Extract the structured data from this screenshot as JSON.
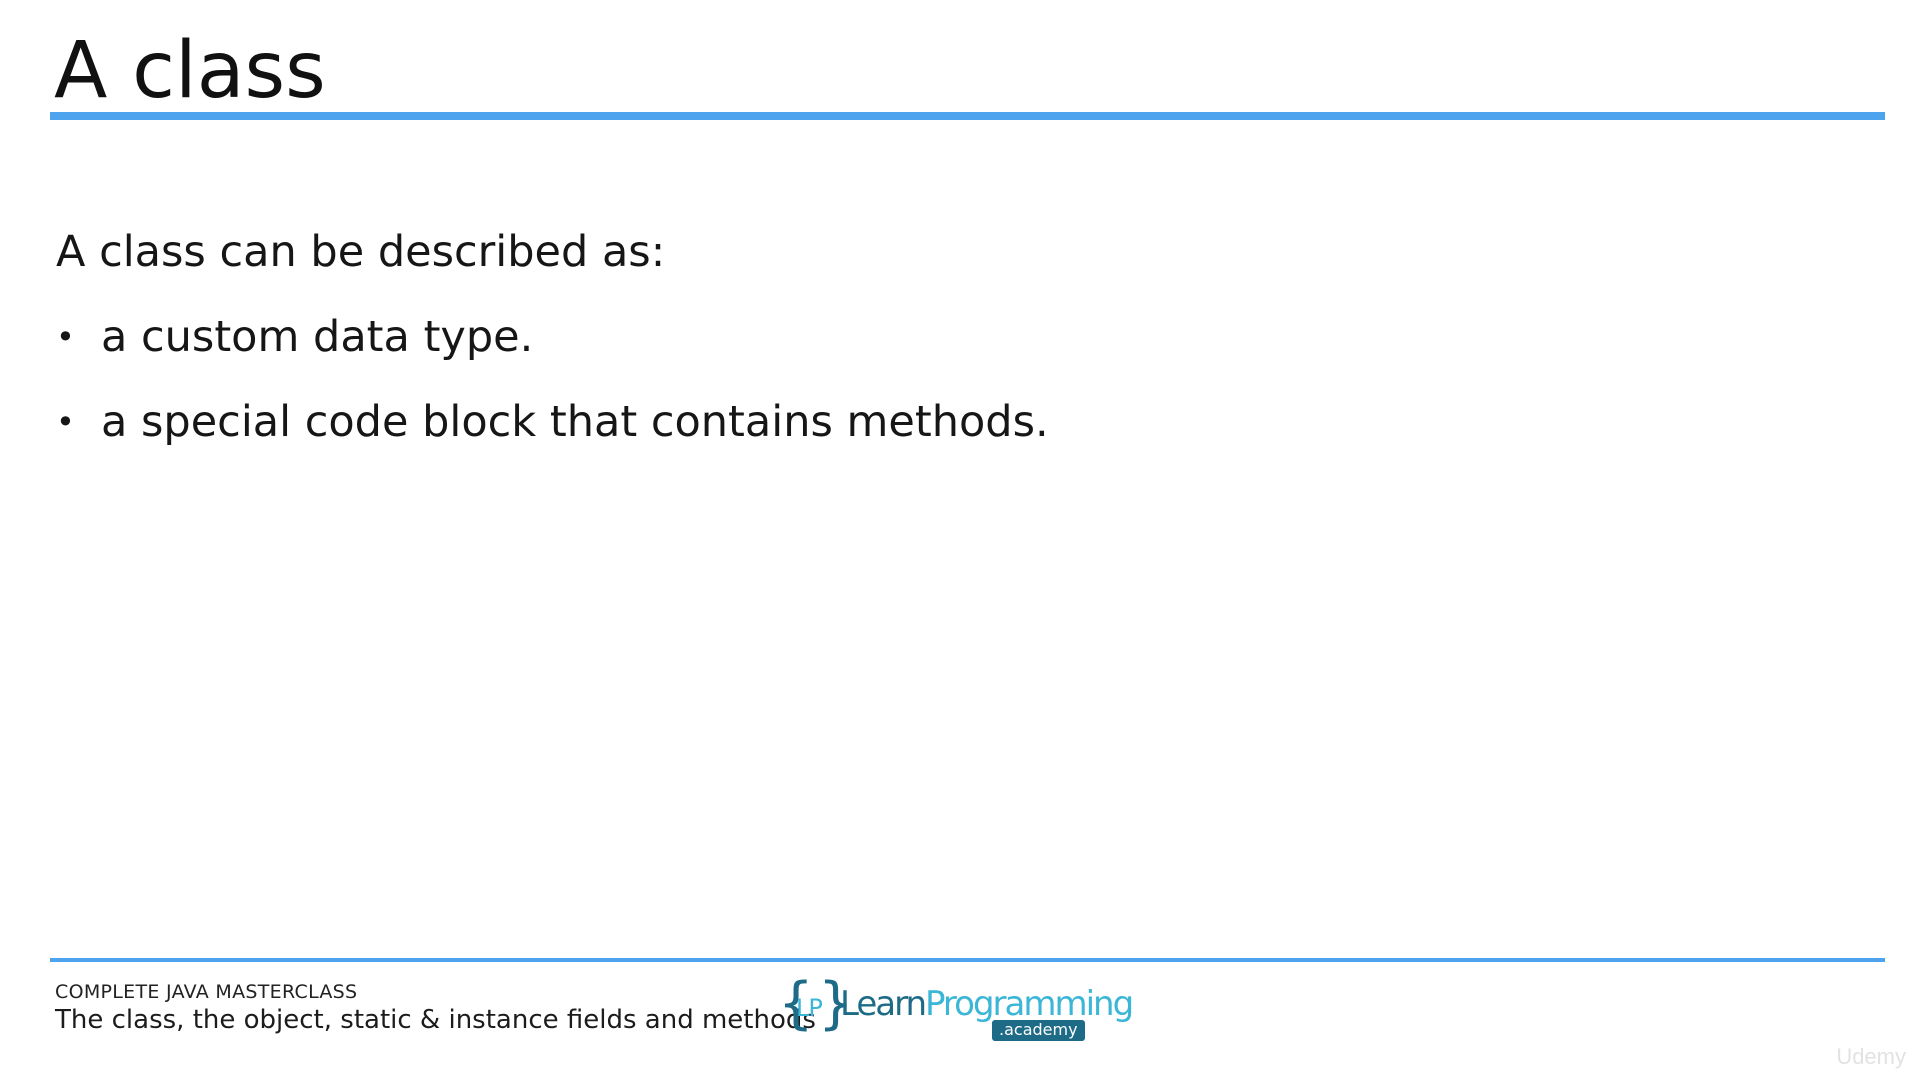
{
  "slide": {
    "title": "A class",
    "intro": "A class can be described as:",
    "bullets": [
      "a custom data type.",
      "a special code block that contains methods."
    ]
  },
  "footer": {
    "course": "COMPLETE JAVA MASTERCLASS",
    "subtitle": "The class, the object, static & instance fields and methods"
  },
  "logo": {
    "brace_open": "{",
    "initials": "LP",
    "brace_close": "}",
    "word_learn": "Learn",
    "word_programming": "Programming",
    "academy": ".academy"
  },
  "watermark": "Udemy",
  "colors": {
    "accent_rule": "#4da3ee",
    "logo_dark": "#1d6b86",
    "logo_light": "#3bb6d6"
  }
}
